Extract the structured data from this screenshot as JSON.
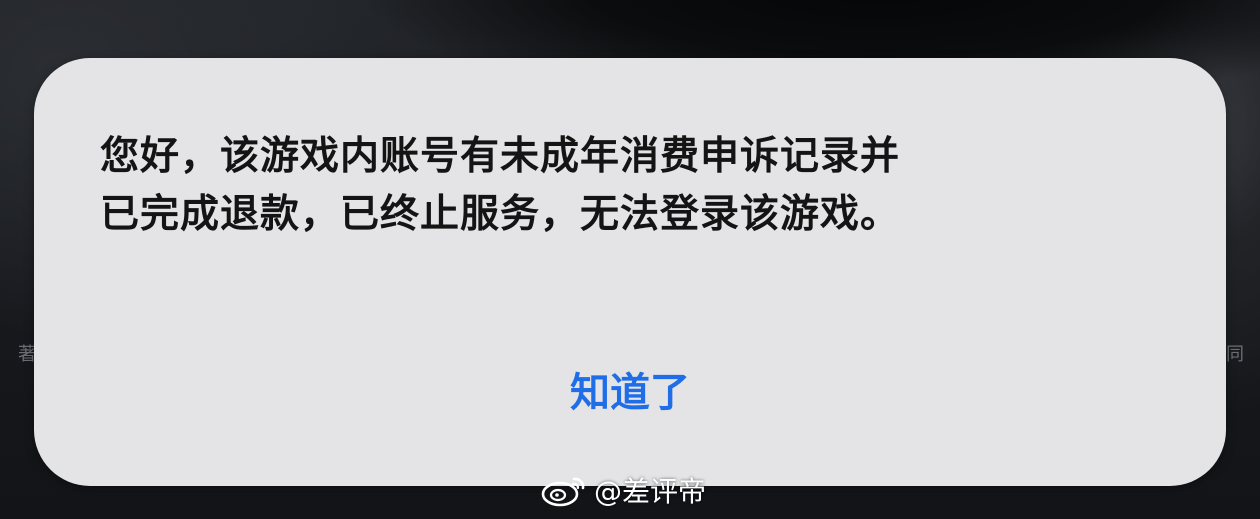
{
  "dialog": {
    "message_lines": [
      "您好，该游戏内账号有未成年消费申诉记录并",
      "已完成退款，已终止服务，无法登录该游戏。"
    ],
    "confirm_button": "知道了"
  },
  "background": {
    "left_char": "著",
    "right_char": "同"
  },
  "watermark": {
    "icon": "weibo-logo",
    "text": "@差评帝"
  },
  "colors": {
    "dialog_bg": "#e4e4e6",
    "button_accent": "#1f6ee8",
    "message_text": "#141414"
  }
}
